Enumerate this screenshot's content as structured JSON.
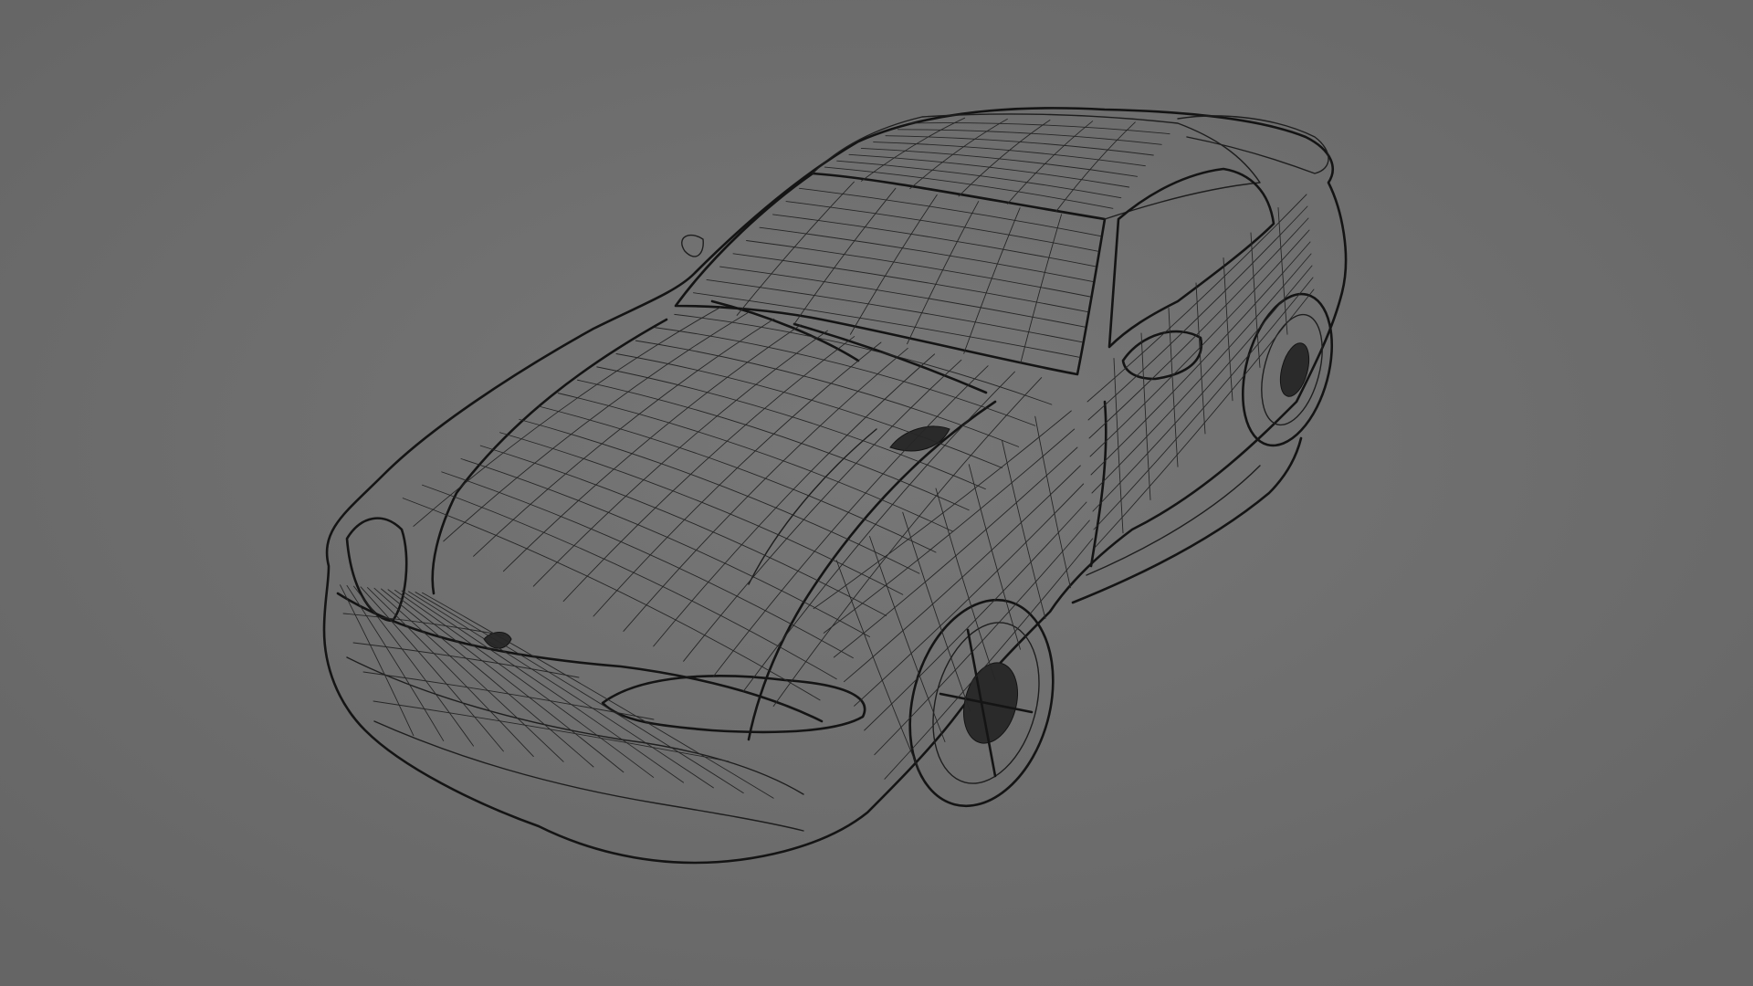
{
  "viewport": {
    "background_color": "#6b6b6b",
    "background_center_color": "#787878",
    "wire_color": "#1e1e1e",
    "display_mode": "wireframe",
    "subject_icon": "sports-coupe-wireframe-model"
  }
}
